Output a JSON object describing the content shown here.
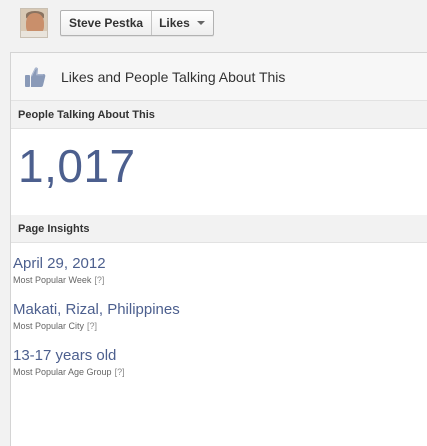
{
  "topbar": {
    "page_name": "Steve Pestka",
    "menu_label": "Likes"
  },
  "panel": {
    "title": "Likes and People Talking About This",
    "talking_section": "People Talking About This",
    "talking_count": "1,017",
    "insights_section": "Page Insights",
    "insights": [
      {
        "value": "April 29, 2012",
        "label": "Most Popular Week",
        "help": "[?]"
      },
      {
        "value": "Makati, Rizal, Philippines",
        "label": "Most Popular City",
        "help": "[?]"
      },
      {
        "value": "13-17 years old",
        "label": "Most Popular Age Group",
        "help": "[?]"
      }
    ]
  },
  "colors": {
    "accent": "#4c5f8e",
    "panel_bg": "#ffffff",
    "page_bg": "#f2f2f2"
  },
  "icons": [
    "thumbs-up-icon",
    "chevron-down-icon"
  ]
}
